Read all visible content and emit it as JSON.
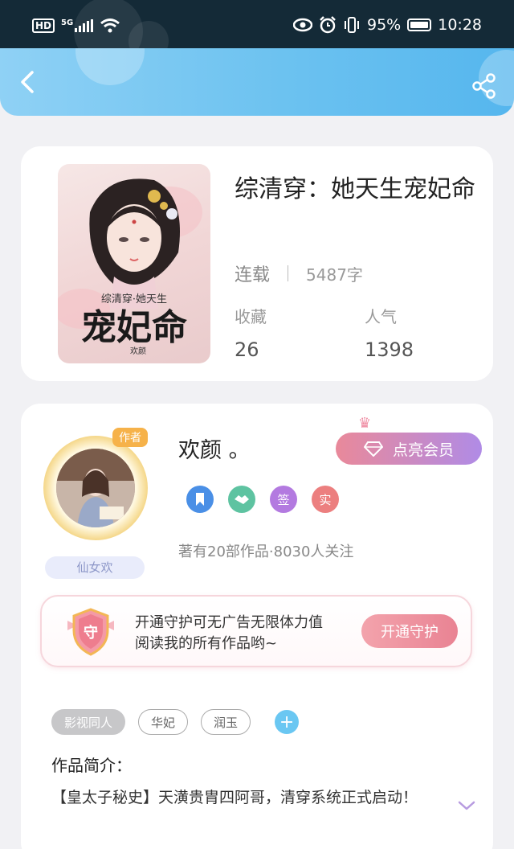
{
  "status_bar": {
    "network_label": "HD",
    "net_type": "5G",
    "battery": "95%",
    "time": "10:28"
  },
  "header": {
    "back_icon": "chevron-left-icon",
    "share_icon": "share-icon"
  },
  "book": {
    "title": "综清穿：她天生宠妃命",
    "status": "连载",
    "word_count": "5487字",
    "favorites_label": "收藏",
    "favorites_value": "26",
    "popularity_label": "人气",
    "popularity_value": "1398"
  },
  "author": {
    "name": "欢颜 。",
    "avatar_badge": "作者",
    "fan_group": "仙女欢",
    "vip_button": "点亮会员",
    "badges": [
      "",
      "",
      "签",
      "实"
    ],
    "works_info": "著有20部作品·8030人关注"
  },
  "guard": {
    "shield_char": "守",
    "line1": "开通守护可无广告无限体力值",
    "line2": "阅读我的所有作品哟~",
    "button": "开通守护"
  },
  "tags": [
    "影视同人",
    "华妃",
    "润玉"
  ],
  "intro": {
    "title": "作品简介：",
    "text": "【皇太子秘史】天潢贵胄四阿哥，清穿系统正式启动！"
  },
  "colors": {
    "header_start": "#8fd1f5",
    "header_end": "#55b6ee",
    "vip_start": "#e9899a",
    "vip_end": "#b08be6",
    "guard_button": "#e98393",
    "tag_add": "#6ac7f2"
  }
}
